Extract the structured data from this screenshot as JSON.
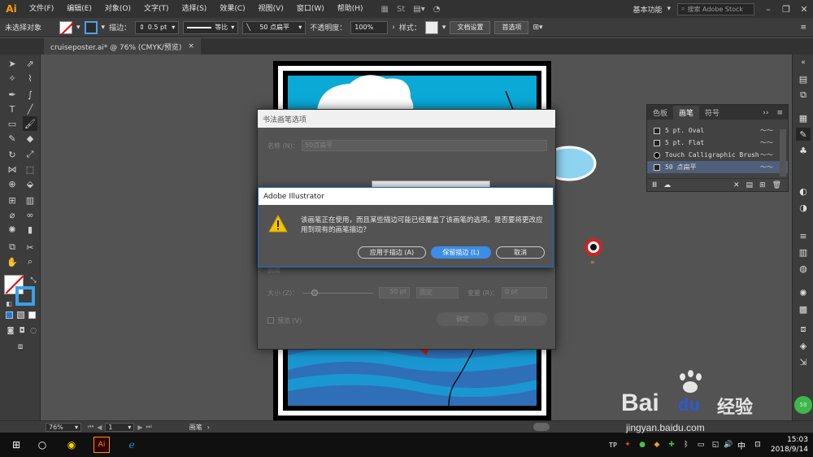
{
  "app": {
    "logo": "Ai"
  },
  "menu": [
    "文件(F)",
    "编辑(E)",
    "对象(O)",
    "文字(T)",
    "选择(S)",
    "效果(C)",
    "视图(V)",
    "窗口(W)",
    "帮助(H)"
  ],
  "menu_right": {
    "workspace": "基本功能",
    "stock_search_placeholder": "搜索 Adobe Stock"
  },
  "controlbar": {
    "selection": "未选择对象",
    "stroke_label": "描边：",
    "stroke_value": "0.5 pt",
    "profile": "等比",
    "brush": "50 点扁平",
    "opacity_label": "不透明度：",
    "opacity_value": "100%",
    "style_label": "样式：",
    "doc_setup": "文档设置",
    "prefs": "首选项"
  },
  "document_tab": {
    "title": "cruiseposter.ai* @ 76% (CMYK/预览)",
    "close": "×"
  },
  "brush_panel": {
    "tabs": [
      "色板",
      "画笔",
      "符号"
    ],
    "items": [
      {
        "label": "5 pt. Oval",
        "selected": false
      },
      {
        "label": "5 pt. Flat",
        "selected": false
      },
      {
        "label": "Touch Calligraphic Brush",
        "selected": false
      },
      {
        "label": "50 点扁平",
        "selected": true
      }
    ]
  },
  "brush_dialog": {
    "title": "书法画笔选项",
    "name_label": "名称 (N)：",
    "name_value": "50点扁平",
    "size_label": "大小 (Z)：",
    "size_value": "50 pt",
    "fixed": "固定",
    "variation_label": "变量 (R)：",
    "variation_value": "0 pt",
    "preview": "预览 (V)",
    "ok": "确定",
    "cancel": "取消",
    "angle_label": "圆度"
  },
  "alert": {
    "title": "Adobe Illustrator",
    "message": "该画笔正在使用，而且某些描边可能已经覆盖了该画笔的选项。是否要将更改应用到现有的画笔描边？",
    "apply_button": "应用于描边 (A)",
    "keep_button": "保留描边 (L)",
    "cancel_button": "取消"
  },
  "statusbar": {
    "zoom": "76%",
    "page": "1",
    "tool": "画笔"
  },
  "taskbar": {
    "time": "15:03",
    "date": "2018/9/14",
    "ime": "中"
  },
  "watermark": {
    "brand": "Bai",
    "brand2": "du",
    "cn": "经验",
    "url": "jingyan.baidu.com"
  },
  "colors": {
    "accent": "#3c8de8",
    "app_orange": "#ff9a00",
    "sea": "#0aa9d6",
    "deep_sea": "#2f6fb8"
  }
}
